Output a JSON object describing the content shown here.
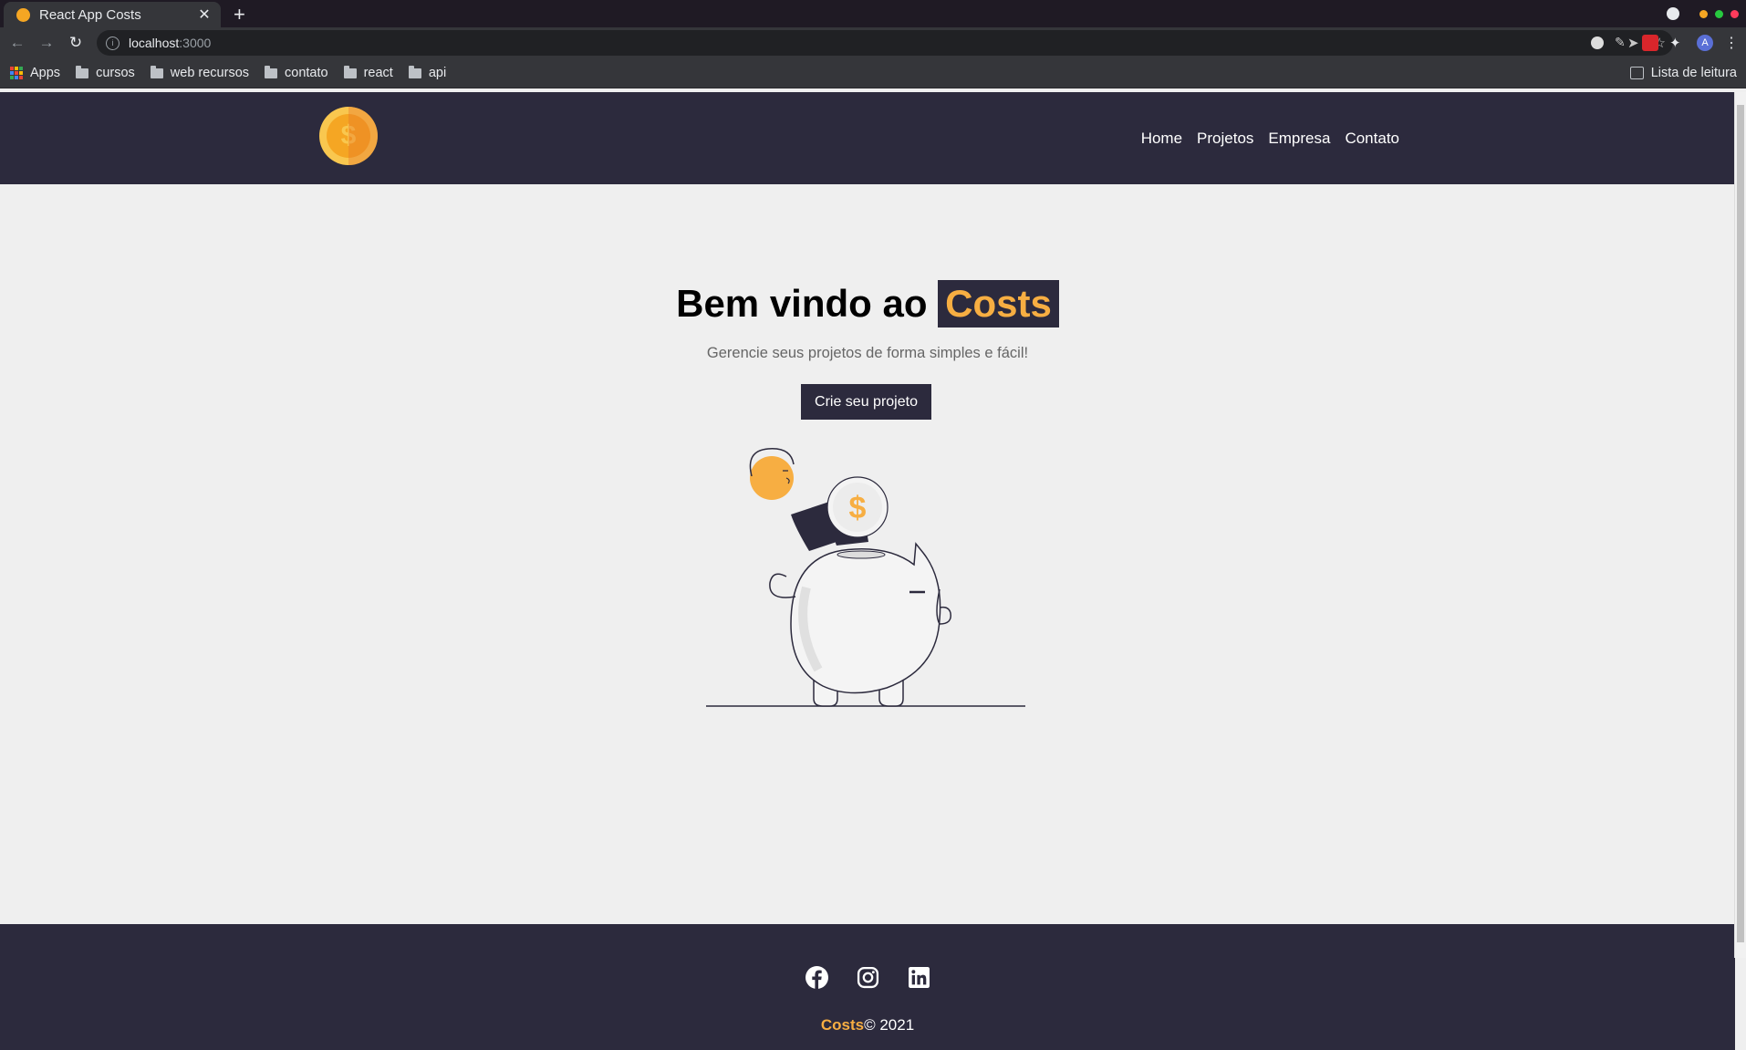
{
  "browser": {
    "tab_title": "React App Costs",
    "url_host": "localhost",
    "url_port": ":3000",
    "bookmarks": [
      "Apps",
      "cursos",
      "web recursos",
      "contato",
      "react",
      "api"
    ],
    "reading_list": "Lista de leitura",
    "profile_initial": "A"
  },
  "navbar": {
    "links": [
      "Home",
      "Projetos",
      "Empresa",
      "Contato"
    ]
  },
  "hero": {
    "title_prefix": "Bem vindo ao",
    "title_brand": "Costs",
    "subtitle": "Gerencie seus projetos de forma simples e fácil!",
    "cta_label": "Crie seu projeto"
  },
  "footer": {
    "brand": "Costs",
    "copyright": "© 2021",
    "social_icons": [
      "facebook-icon",
      "instagram-icon",
      "linkedin-icon"
    ]
  },
  "colors": {
    "primary_dark": "#2c2a3d",
    "accent": "#f7ae42",
    "background": "#efefef"
  }
}
